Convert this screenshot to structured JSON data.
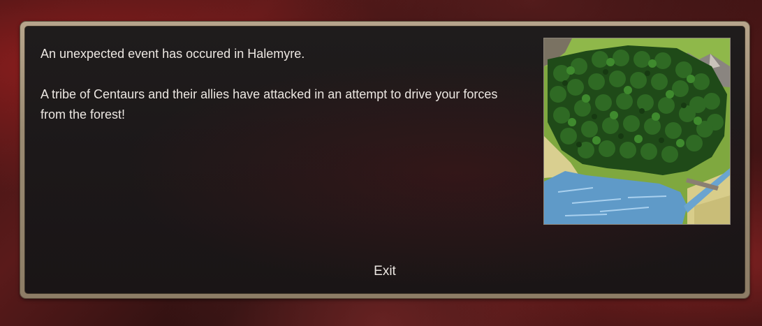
{
  "event": {
    "line1": "An unexpected event has occured in Halemyre.",
    "line2": "A tribe of Centaurs and their allies have attacked in an attempt to drive your forces from the forest!"
  },
  "image": {
    "icon": "forest-map-icon"
  },
  "buttons": {
    "exit_label": "Exit"
  },
  "colors": {
    "text": "#ece7e2",
    "frame": "#a8977e",
    "panel": "#1d1919"
  }
}
